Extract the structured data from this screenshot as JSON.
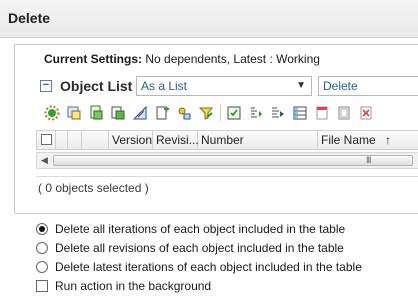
{
  "window": {
    "title": "Delete"
  },
  "settings": {
    "label": "Current Settings:",
    "value": "No dependents, Latest : Working"
  },
  "object_list": {
    "title": "Object List",
    "view_select": "As a List",
    "action_select": "Delete"
  },
  "toolbar": {
    "icons": [
      "collect-related-icon",
      "add-objects-icon",
      "add-dependents-icon",
      "add-required-icon",
      "add-drawings-icon",
      "add-references-icon",
      "set-filter-icon",
      "add-to-workspace-icon",
      "expand-icon",
      "columns-icon",
      "delete-row-icon",
      "clear-icon",
      "remove-icon"
    ]
  },
  "table": {
    "columns": [
      "Version",
      "Revisi...",
      "Number",
      "File Name"
    ],
    "sort_column": "File Name",
    "sort_indicator": "↑",
    "rows": []
  },
  "scrollbar": {
    "grip": "III"
  },
  "status": "( 0 objects selected )",
  "options": [
    {
      "label": "Delete all iterations of each object included in the table",
      "type": "radio",
      "checked": true
    },
    {
      "label": "Delete all revisions of each object included in the table",
      "type": "radio",
      "checked": false
    },
    {
      "label": "Delete latest iterations of each object included in the table",
      "type": "radio",
      "checked": false
    },
    {
      "label": "Run action in the background",
      "type": "checkbox",
      "checked": false
    }
  ]
}
